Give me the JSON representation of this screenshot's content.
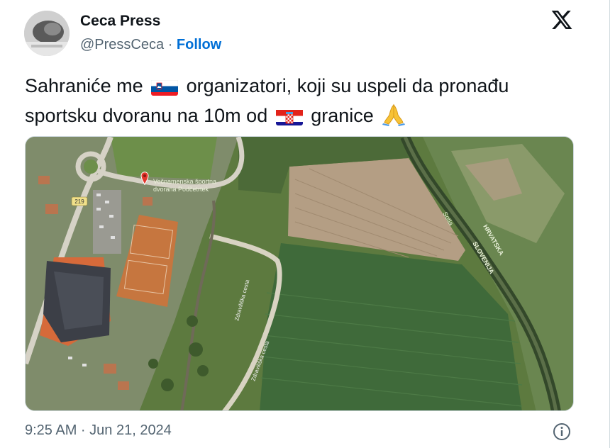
{
  "author": {
    "display_name": "Ceca Press",
    "handle": "@PressCeca",
    "separator": "·",
    "follow_label": "Follow"
  },
  "platform_icon": "x-logo-icon",
  "tweet": {
    "text_part1": "Sahraniće me",
    "flag1": "slovenia-flag-icon",
    "text_part2": "organizatori, koji su uspeli da pronađu sportsku dvoranu na 10m od",
    "flag2": "croatia-flag-icon",
    "text_part3": "granice",
    "emoji": "folded-hands-icon"
  },
  "map": {
    "label_line1": "Večnamenska športna",
    "label_line2": "dvorana Podčetrtek",
    "road_number": "219",
    "road_label1": "Zdraviliška cesta",
    "road_label2": "Zdraviliška cesta",
    "river_label": "Sotla",
    "border_label1": "HRVATSKA",
    "border_label2": "SLOVENIJA"
  },
  "timestamp": "9:25 AM · Jun 21, 2024",
  "info_icon": "info-icon"
}
